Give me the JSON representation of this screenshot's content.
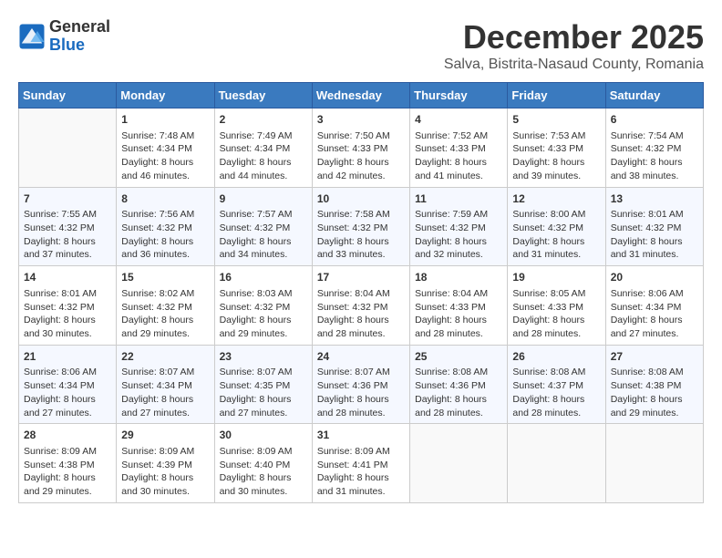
{
  "header": {
    "logo_general": "General",
    "logo_blue": "Blue",
    "title": "December 2025",
    "subtitle": "Salva, Bistrita-Nasaud County, Romania"
  },
  "calendar": {
    "days_of_week": [
      "Sunday",
      "Monday",
      "Tuesday",
      "Wednesday",
      "Thursday",
      "Friday",
      "Saturday"
    ],
    "weeks": [
      [
        {
          "day": "",
          "content": ""
        },
        {
          "day": "1",
          "content": "Sunrise: 7:48 AM\nSunset: 4:34 PM\nDaylight: 8 hours\nand 46 minutes."
        },
        {
          "day": "2",
          "content": "Sunrise: 7:49 AM\nSunset: 4:34 PM\nDaylight: 8 hours\nand 44 minutes."
        },
        {
          "day": "3",
          "content": "Sunrise: 7:50 AM\nSunset: 4:33 PM\nDaylight: 8 hours\nand 42 minutes."
        },
        {
          "day": "4",
          "content": "Sunrise: 7:52 AM\nSunset: 4:33 PM\nDaylight: 8 hours\nand 41 minutes."
        },
        {
          "day": "5",
          "content": "Sunrise: 7:53 AM\nSunset: 4:33 PM\nDaylight: 8 hours\nand 39 minutes."
        },
        {
          "day": "6",
          "content": "Sunrise: 7:54 AM\nSunset: 4:32 PM\nDaylight: 8 hours\nand 38 minutes."
        }
      ],
      [
        {
          "day": "7",
          "content": "Sunrise: 7:55 AM\nSunset: 4:32 PM\nDaylight: 8 hours\nand 37 minutes."
        },
        {
          "day": "8",
          "content": "Sunrise: 7:56 AM\nSunset: 4:32 PM\nDaylight: 8 hours\nand 36 minutes."
        },
        {
          "day": "9",
          "content": "Sunrise: 7:57 AM\nSunset: 4:32 PM\nDaylight: 8 hours\nand 34 minutes."
        },
        {
          "day": "10",
          "content": "Sunrise: 7:58 AM\nSunset: 4:32 PM\nDaylight: 8 hours\nand 33 minutes."
        },
        {
          "day": "11",
          "content": "Sunrise: 7:59 AM\nSunset: 4:32 PM\nDaylight: 8 hours\nand 32 minutes."
        },
        {
          "day": "12",
          "content": "Sunrise: 8:00 AM\nSunset: 4:32 PM\nDaylight: 8 hours\nand 31 minutes."
        },
        {
          "day": "13",
          "content": "Sunrise: 8:01 AM\nSunset: 4:32 PM\nDaylight: 8 hours\nand 31 minutes."
        }
      ],
      [
        {
          "day": "14",
          "content": "Sunrise: 8:01 AM\nSunset: 4:32 PM\nDaylight: 8 hours\nand 30 minutes."
        },
        {
          "day": "15",
          "content": "Sunrise: 8:02 AM\nSunset: 4:32 PM\nDaylight: 8 hours\nand 29 minutes."
        },
        {
          "day": "16",
          "content": "Sunrise: 8:03 AM\nSunset: 4:32 PM\nDaylight: 8 hours\nand 29 minutes."
        },
        {
          "day": "17",
          "content": "Sunrise: 8:04 AM\nSunset: 4:32 PM\nDaylight: 8 hours\nand 28 minutes."
        },
        {
          "day": "18",
          "content": "Sunrise: 8:04 AM\nSunset: 4:33 PM\nDaylight: 8 hours\nand 28 minutes."
        },
        {
          "day": "19",
          "content": "Sunrise: 8:05 AM\nSunset: 4:33 PM\nDaylight: 8 hours\nand 28 minutes."
        },
        {
          "day": "20",
          "content": "Sunrise: 8:06 AM\nSunset: 4:34 PM\nDaylight: 8 hours\nand 27 minutes."
        }
      ],
      [
        {
          "day": "21",
          "content": "Sunrise: 8:06 AM\nSunset: 4:34 PM\nDaylight: 8 hours\nand 27 minutes."
        },
        {
          "day": "22",
          "content": "Sunrise: 8:07 AM\nSunset: 4:34 PM\nDaylight: 8 hours\nand 27 minutes."
        },
        {
          "day": "23",
          "content": "Sunrise: 8:07 AM\nSunset: 4:35 PM\nDaylight: 8 hours\nand 27 minutes."
        },
        {
          "day": "24",
          "content": "Sunrise: 8:07 AM\nSunset: 4:36 PM\nDaylight: 8 hours\nand 28 minutes."
        },
        {
          "day": "25",
          "content": "Sunrise: 8:08 AM\nSunset: 4:36 PM\nDaylight: 8 hours\nand 28 minutes."
        },
        {
          "day": "26",
          "content": "Sunrise: 8:08 AM\nSunset: 4:37 PM\nDaylight: 8 hours\nand 28 minutes."
        },
        {
          "day": "27",
          "content": "Sunrise: 8:08 AM\nSunset: 4:38 PM\nDaylight: 8 hours\nand 29 minutes."
        }
      ],
      [
        {
          "day": "28",
          "content": "Sunrise: 8:09 AM\nSunset: 4:38 PM\nDaylight: 8 hours\nand 29 minutes."
        },
        {
          "day": "29",
          "content": "Sunrise: 8:09 AM\nSunset: 4:39 PM\nDaylight: 8 hours\nand 30 minutes."
        },
        {
          "day": "30",
          "content": "Sunrise: 8:09 AM\nSunset: 4:40 PM\nDaylight: 8 hours\nand 30 minutes."
        },
        {
          "day": "31",
          "content": "Sunrise: 8:09 AM\nSunset: 4:41 PM\nDaylight: 8 hours\nand 31 minutes."
        },
        {
          "day": "",
          "content": ""
        },
        {
          "day": "",
          "content": ""
        },
        {
          "day": "",
          "content": ""
        }
      ]
    ]
  }
}
